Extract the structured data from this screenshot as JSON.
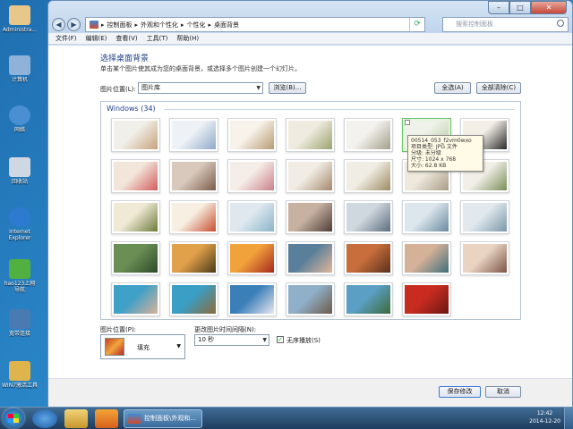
{
  "desktop": {
    "icons": [
      {
        "label": "Administra...",
        "color": "#e8c78a"
      },
      {
        "label": "计算机",
        "color": "#8fb2d8"
      },
      {
        "label": "网络",
        "color": "#4a8fd1"
      },
      {
        "label": "回收站",
        "color": "#cfd8e2"
      },
      {
        "label": "Internet Explorer",
        "color": "#2d7bd1"
      },
      {
        "label": "hao123上网导航",
        "color": "#51b040"
      },
      {
        "label": "宽带连接",
        "color": "#4a7ab2"
      },
      {
        "label": "WIN7激活工具",
        "color": "#e0b44c"
      }
    ]
  },
  "window": {
    "buttons": {
      "minimize": "–",
      "maximize": "□",
      "close": "✕"
    },
    "nav": {
      "back": "◀",
      "forward": "▶"
    },
    "breadcrumb": [
      "控制面板",
      "外观和个性化",
      "个性化",
      "桌面背景"
    ],
    "search_placeholder": "搜索控制面板",
    "menu": [
      "文件(F)",
      "编辑(E)",
      "查看(V)",
      "工具(T)",
      "帮助(H)"
    ]
  },
  "page": {
    "heading": "选择桌面背景",
    "subtitle": "单击某个图片使其成为您的桌面背景，或选择多个图片创建一个幻灯片。",
    "location_label": "图片位置(L):",
    "location_value": "图片库",
    "browse": "浏览(B)...",
    "select_all": "全选(A)",
    "clear_all": "全部清除(C)"
  },
  "gallery": {
    "group": "Windows (34)",
    "thumbnails": [
      {
        "c1": "#f1efe9",
        "c2": "#c7a27a"
      },
      {
        "c1": "#eef2f6",
        "c2": "#8fa9c8"
      },
      {
        "c1": "#f7f2ea",
        "c2": "#b79a73"
      },
      {
        "c1": "#f0ebe0",
        "c2": "#9ba36f"
      },
      {
        "c1": "#f4f2ee",
        "c2": "#a3a08c"
      },
      {
        "c1": "#eef2e8",
        "c2": "#b9c9a6"
      },
      {
        "c1": "#f3efe7",
        "c2": "#2a2a2a"
      },
      {
        "c1": "#f2e6da",
        "c2": "#d35b5b"
      },
      {
        "c1": "#d8c9bc",
        "c2": "#7c5c4a"
      },
      {
        "c1": "#f5eee8",
        "c2": "#c9808a"
      },
      {
        "c1": "#f1ece4",
        "c2": "#a38a6c"
      },
      {
        "c1": "#f0ede4",
        "c2": "#9d8a62"
      },
      {
        "c1": "#eee8dd",
        "c2": "#a89d86"
      },
      {
        "c1": "#f1efe7",
        "c2": "#7b8f5a"
      },
      {
        "c1": "#efe9d5",
        "c2": "#6d7a3a"
      },
      {
        "c1": "#f6efe2",
        "c2": "#c84d2e"
      },
      {
        "c1": "#dfe8ef",
        "c2": "#8ab4c9"
      },
      {
        "c1": "#c7b2a2",
        "c2": "#4e3d36"
      },
      {
        "c1": "#cfd7df",
        "c2": "#5d6e7c"
      },
      {
        "c1": "#dce6ec",
        "c2": "#6b8aa0"
      },
      {
        "c1": "#e1e9ee",
        "c2": "#7a97a8"
      },
      {
        "c1": "#6a8f55",
        "c2": "#2d4a28"
      },
      {
        "c1": "#e1a04a",
        "c2": "#4a3a18"
      },
      {
        "c1": "#f2a23b",
        "c2": "#a6291e"
      },
      {
        "c1": "#5a7f9a",
        "c2": "#e0b79a"
      },
      {
        "c1": "#c86e3c",
        "c2": "#5a2f1a"
      },
      {
        "c1": "#d5b198",
        "c2": "#3e6f7a"
      },
      {
        "c1": "#e9d4c4",
        "c2": "#7d5446"
      },
      {
        "c1": "#3fa0c8",
        "c2": "#d9b297"
      },
      {
        "c1": "#3b9ec4",
        "c2": "#8e6a3a"
      },
      {
        "c1": "#3b7fb8",
        "c2": "#e8e8f0"
      },
      {
        "c1": "#8fb0c8",
        "c2": "#6d5a4a"
      },
      {
        "c1": "#5b9fc4",
        "c2": "#3c6a3a"
      },
      {
        "c1": "#c82c20",
        "c2": "#6a1812"
      }
    ],
    "selected_index": 5,
    "tooltip": {
      "name": "00514_053_f2vm0wxo",
      "type": "项目类型: JPG 文件",
      "rating": "分级: 未分级",
      "size": "尺寸: 1024 x 768",
      "filesize": "大小: 62.8 KB"
    }
  },
  "options": {
    "position_label": "图片位置(P):",
    "position_value": "填充",
    "interval_label": "更改图片时间间隔(N):",
    "interval_value": "10 秒",
    "shuffle_label": "无序播放(S)",
    "shuffle_checked": "✓"
  },
  "footer": {
    "save": "保存修改",
    "cancel": "取消"
  },
  "taskbar": {
    "active_window": "控制面板\\外观和...",
    "time": "12:42",
    "date": "2014-12-20"
  }
}
